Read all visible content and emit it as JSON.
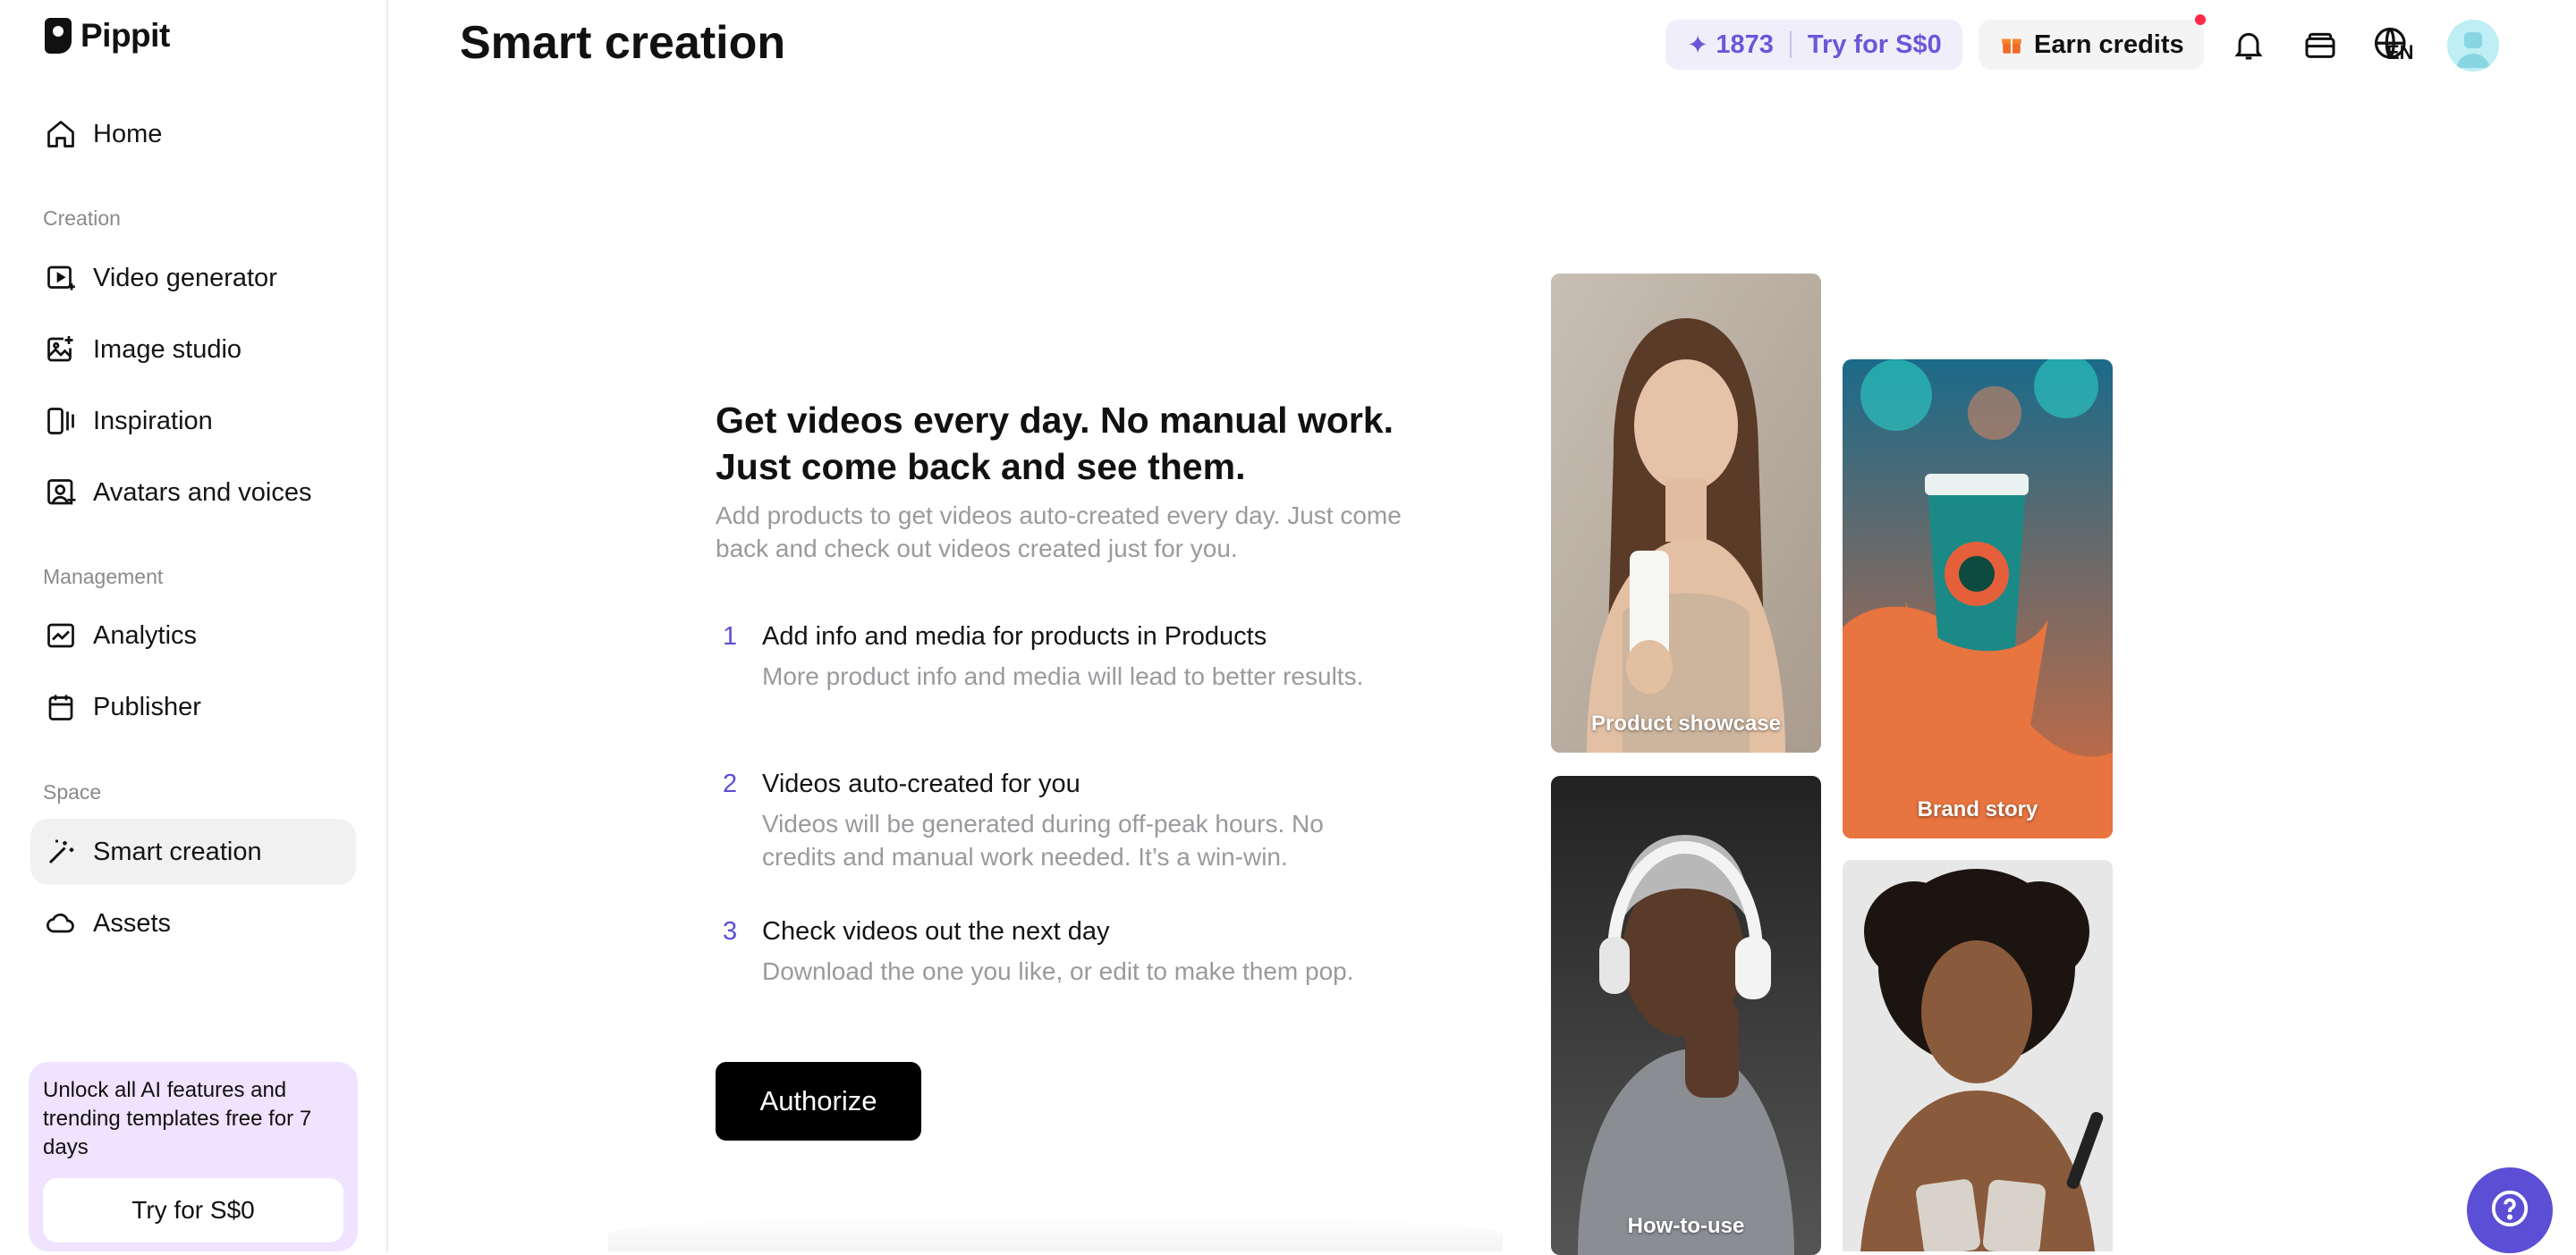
{
  "app": {
    "name": "Pippit"
  },
  "sidebar": {
    "home": {
      "label": "Home",
      "icon": "home-icon"
    },
    "sections": {
      "creation": "Creation",
      "management": "Management",
      "space": "Space"
    },
    "creation_items": [
      {
        "label": "Video generator",
        "icon": "video-generator-icon"
      },
      {
        "label": "Image studio",
        "icon": "image-studio-icon"
      },
      {
        "label": "Inspiration",
        "icon": "inspiration-icon"
      },
      {
        "label": "Avatars and voices",
        "icon": "avatar-voice-icon"
      }
    ],
    "management_items": [
      {
        "label": "Analytics",
        "icon": "analytics-icon"
      },
      {
        "label": "Publisher",
        "icon": "calendar-icon"
      }
    ],
    "space_items": [
      {
        "label": "Smart creation",
        "icon": "magic-wand-icon",
        "active": true
      },
      {
        "label": "Assets",
        "icon": "cloud-icon"
      }
    ],
    "promo": {
      "text": "Unlock all AI features and trending templates free for 7 days",
      "button": "Try for S$0"
    }
  },
  "header": {
    "title": "Smart creation",
    "credits": "1873",
    "try_label": "Try for S$0",
    "earn_label": "Earn credits",
    "language": "EN"
  },
  "main": {
    "headline": "Get videos every day. No manual work. Just come back and see them.",
    "subline": "Add products to get videos auto-created every day. Just come back and check out videos created just for you.",
    "steps": [
      {
        "num": "1",
        "title": "Add info and media for products in Products",
        "desc": "More product info and media will lead to better results."
      },
      {
        "num": "2",
        "title": "Videos auto-created for you",
        "desc": "Videos will be generated during off-peak hours. No credits and manual work needed. It’s a win-win."
      },
      {
        "num": "3",
        "title": "Check videos out the next day",
        "desc": "Download the one you like, or edit to make them pop."
      }
    ],
    "authorize_label": "Authorize",
    "cards": [
      {
        "label": "Product showcase"
      },
      {
        "label": "Brand story"
      },
      {
        "label": "How-to-use"
      },
      {
        "label": ""
      }
    ]
  },
  "colors": {
    "accent": "#5b4fd6",
    "promo_bg": "#efe3ff",
    "credits_bg": "#f1eefb",
    "notification": "#ff2a48"
  }
}
